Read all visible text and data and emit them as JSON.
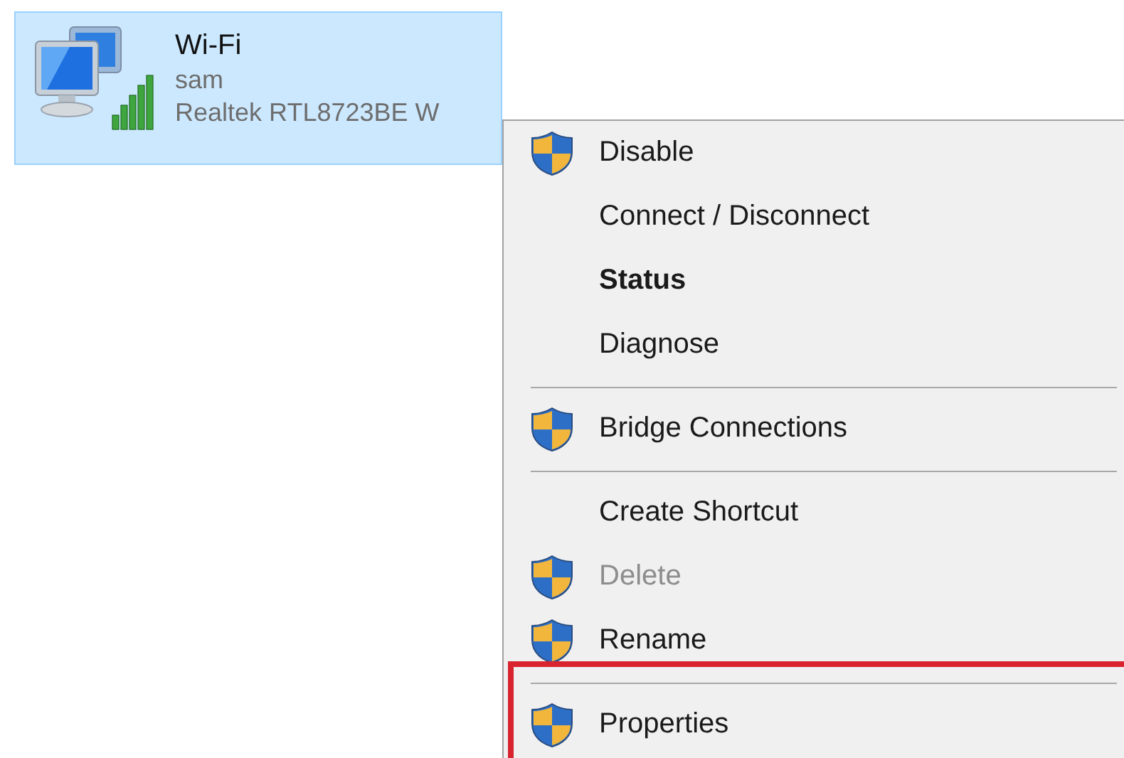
{
  "adapter": {
    "name": "Wi-Fi",
    "network": "sam",
    "device": "Realtek RTL8723BE W",
    "selected": true
  },
  "context_menu": {
    "items": [
      {
        "kind": "item",
        "label": "Disable",
        "shield": true,
        "default": false,
        "disabled": false,
        "highlighted": false
      },
      {
        "kind": "item",
        "label": "Connect / Disconnect",
        "shield": false,
        "default": false,
        "disabled": false,
        "highlighted": false
      },
      {
        "kind": "item",
        "label": "Status",
        "shield": false,
        "default": true,
        "disabled": false,
        "highlighted": false
      },
      {
        "kind": "item",
        "label": "Diagnose",
        "shield": false,
        "default": false,
        "disabled": false,
        "highlighted": false
      },
      {
        "kind": "separator"
      },
      {
        "kind": "item",
        "label": "Bridge Connections",
        "shield": true,
        "default": false,
        "disabled": false,
        "highlighted": false
      },
      {
        "kind": "separator"
      },
      {
        "kind": "item",
        "label": "Create Shortcut",
        "shield": false,
        "default": false,
        "disabled": false,
        "highlighted": false
      },
      {
        "kind": "item",
        "label": "Delete",
        "shield": true,
        "default": false,
        "disabled": true,
        "highlighted": false
      },
      {
        "kind": "item",
        "label": "Rename",
        "shield": true,
        "default": false,
        "disabled": false,
        "highlighted": false
      },
      {
        "kind": "separator"
      },
      {
        "kind": "item",
        "label": "Properties",
        "shield": true,
        "default": false,
        "disabled": false,
        "highlighted": true
      }
    ]
  }
}
